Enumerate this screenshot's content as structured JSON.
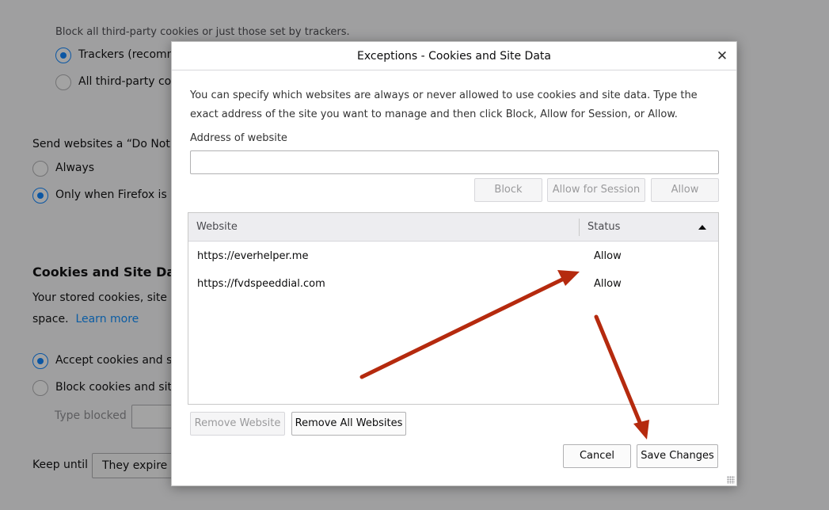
{
  "background": {
    "block_desc": "Block all third-party cookies or just those set by trackers.",
    "trackers_label": "Trackers (recomm",
    "all_third_party_label": "All third-party coo",
    "dnt_label": "Send websites a “Do Not T",
    "always_label": "Always",
    "only_when_label": "Only when Firefox is se",
    "cookies_heading": "Cookies and Site Data",
    "stored_text": "Your stored cookies, site da",
    "space_text": "space.",
    "learn_more": "Learn more",
    "accept_label": "Accept cookies and sit",
    "block_label": "Block cookies and site",
    "type_blocked_label": "Type blocked",
    "keep_until_label": "Keep until",
    "keep_until_value": "They expire"
  },
  "dialog": {
    "title": "Exceptions - Cookies and Site Data",
    "close_glyph": "✕",
    "intro": "You can specify which websites are always or never allowed to use cookies and site data. Type the exact address of the site you want to manage and then click Block, Allow for Session, or Allow.",
    "address_label": "Address of website",
    "address_value": "",
    "buttons": {
      "block": "Block",
      "allow_session": "Allow for Session",
      "allow": "Allow",
      "remove_website": "Remove Website",
      "remove_all": "Remove All Websites",
      "cancel": "Cancel",
      "save": "Save Changes"
    },
    "table": {
      "columns": [
        "Website",
        "Status"
      ],
      "rows": [
        {
          "website": "https://everhelper.me",
          "status": "Allow"
        },
        {
          "website": "https://fvdspeeddial.com",
          "status": "Allow"
        }
      ]
    }
  },
  "colors": {
    "arrow": "#b52a0e",
    "accent": "#0a84ff"
  }
}
